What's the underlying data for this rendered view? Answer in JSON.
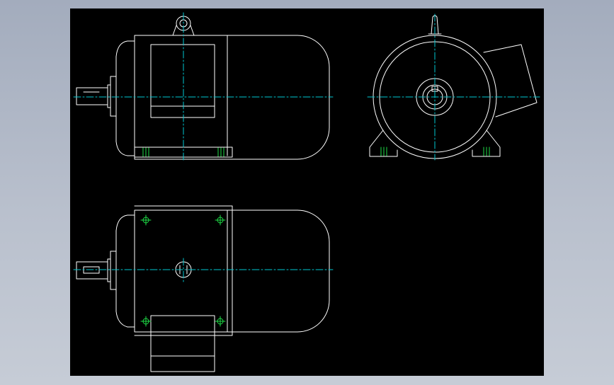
{
  "colors": {
    "background": "#000000",
    "outline": "#ffffff",
    "centerline": "#00c8d2",
    "bolt": "#1edc46",
    "desktop": "#b3bac8"
  },
  "views": [
    "front-view",
    "side-view",
    "top-view"
  ]
}
